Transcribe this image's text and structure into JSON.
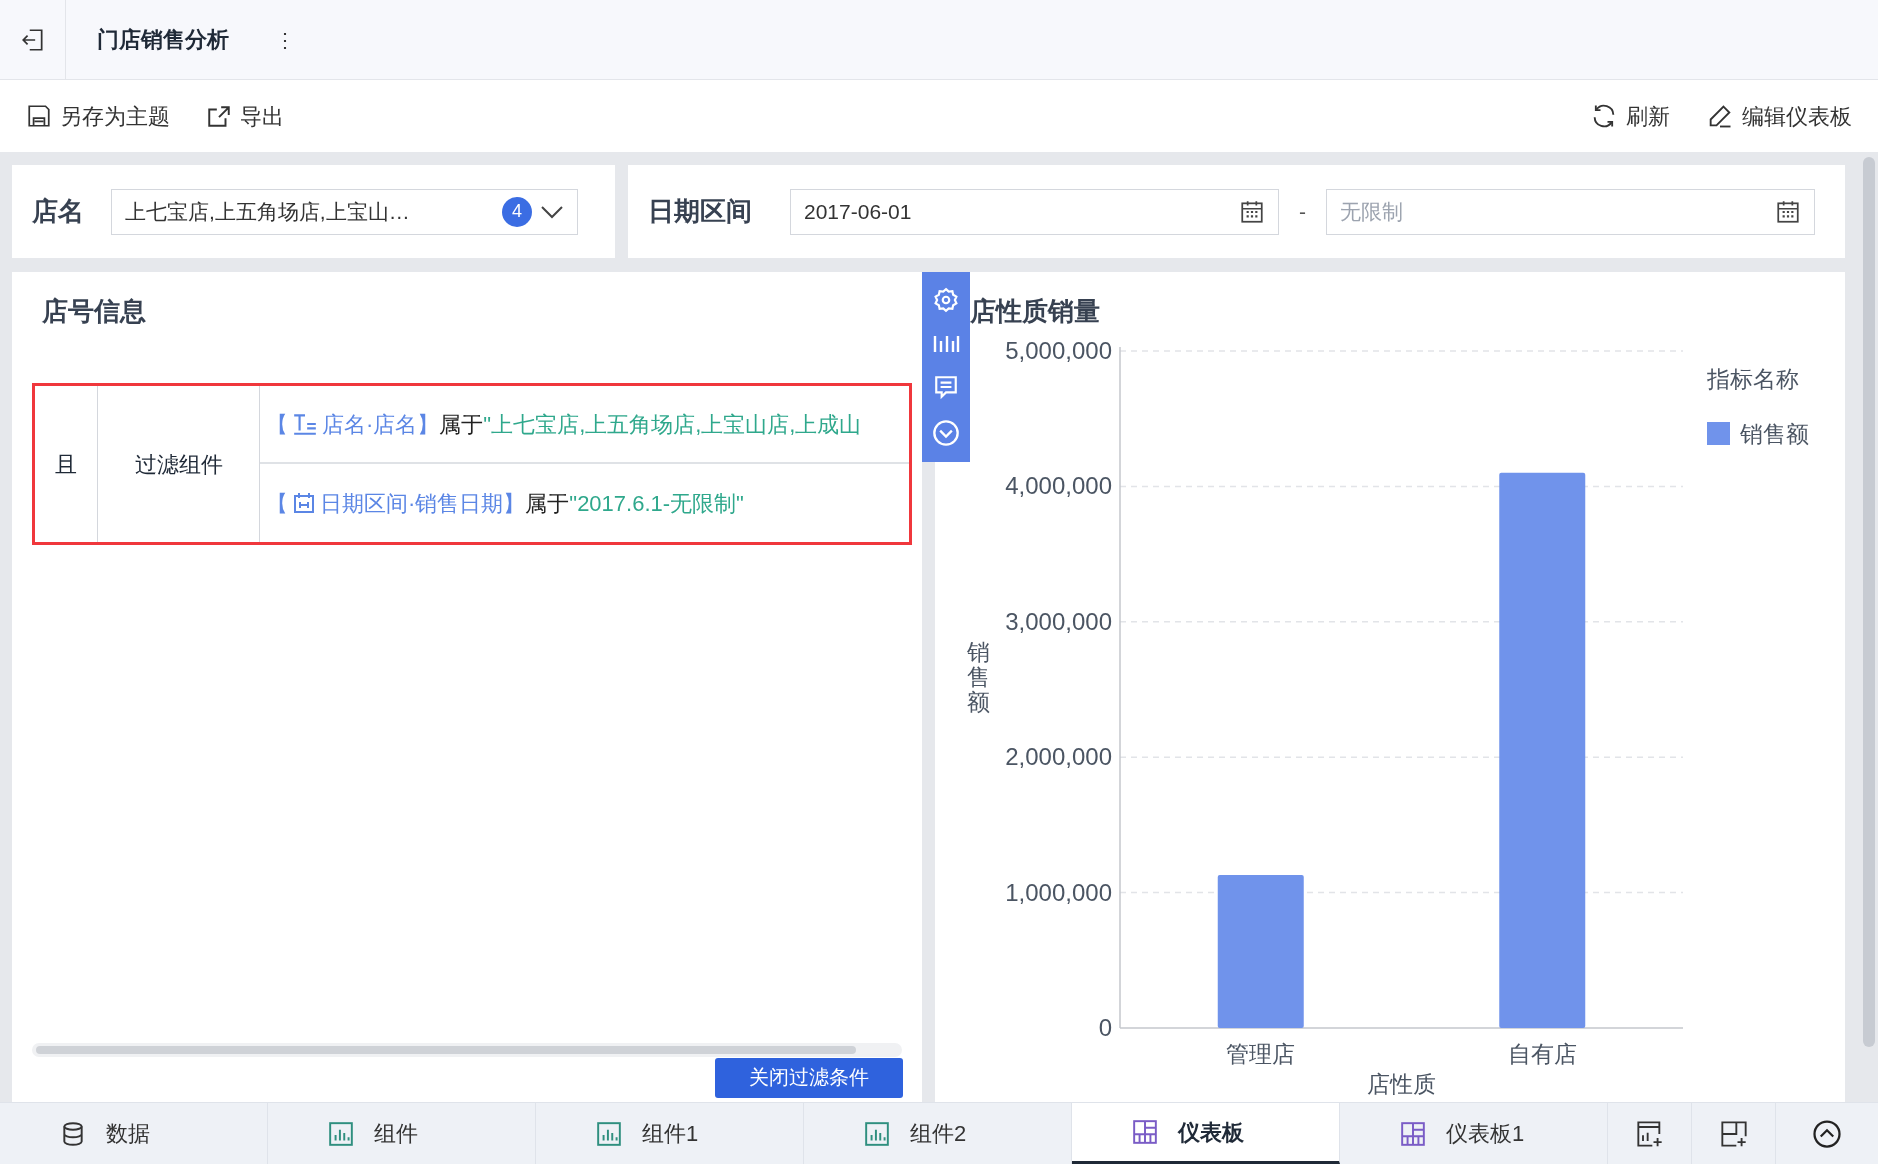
{
  "header": {
    "title": "门店销售分析",
    "more": "⋮"
  },
  "toolbar": {
    "left": [
      {
        "kind": "save",
        "label": "另存为主题"
      },
      {
        "kind": "export",
        "label": "导出"
      }
    ],
    "right": [
      {
        "kind": "refresh",
        "label": "刷新"
      },
      {
        "kind": "edit",
        "label": "编辑仪表板"
      }
    ]
  },
  "filters": {
    "store": {
      "label": "店名",
      "value": "上七宝店,上五角场店,上宝山…",
      "count": "4"
    },
    "date": {
      "label": "日期区间",
      "start": "2017-06-01",
      "separator": "-",
      "end_placeholder": "无限制"
    }
  },
  "info_panel": {
    "title": "店号信息",
    "relation": "且",
    "group": "过滤组件",
    "conditions": [
      {
        "kind": "text",
        "open": "【",
        "field": "店名·店名",
        "close": "】",
        "op": "属于",
        "value": "\"上七宝店,上五角场店,上宝山店,上成山"
      },
      {
        "kind": "date",
        "open": "【",
        "field": "日期区间·销售日期",
        "close": "】",
        "op": "属于",
        "value": "\"2017.6.1-无限制\""
      }
    ],
    "close_button": "关闭过滤条件"
  },
  "chart_panel": {
    "title": "店性质销量",
    "chart_data": {
      "type": "bar",
      "xlabel": "店性质",
      "ylabel": "销售额",
      "categories": [
        "管理店",
        "自有店"
      ],
      "series": [
        {
          "name": "销售额",
          "color": "#7093eb",
          "values": [
            1130000,
            4100000
          ]
        }
      ],
      "ylim": [
        0,
        5000000
      ],
      "yticks": [
        {
          "value": 0,
          "label": "0"
        },
        {
          "value": 1000000,
          "label": "1,000,000"
        },
        {
          "value": 2000000,
          "label": "2,000,000"
        },
        {
          "value": 3000000,
          "label": "3,000,000"
        },
        {
          "value": 4000000,
          "label": "4,000,000"
        },
        {
          "value": 5000000,
          "label": "5,000,000"
        }
      ],
      "legend_title": "指标名称",
      "grid": true
    }
  },
  "bottom_tabs": [
    {
      "kind": "data",
      "label": "数据",
      "selected": false
    },
    {
      "kind": "widget",
      "label": "组件",
      "selected": false
    },
    {
      "kind": "widget",
      "label": "组件1",
      "selected": false
    },
    {
      "kind": "widget",
      "label": "组件2",
      "selected": false
    },
    {
      "kind": "dashboard",
      "label": "仪表板",
      "selected": true
    },
    {
      "kind": "dashboard",
      "label": "仪表板1",
      "selected": false
    }
  ]
}
